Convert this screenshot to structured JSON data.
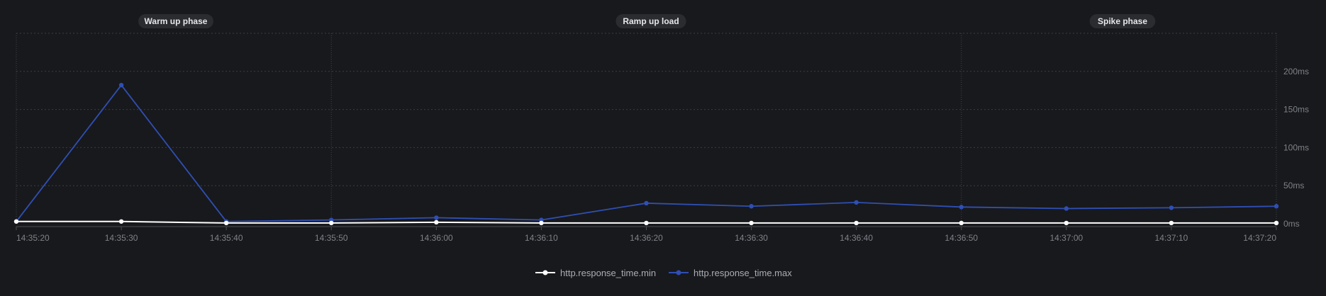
{
  "chart_data": {
    "type": "line",
    "x": [
      "14:35:20",
      "14:35:30",
      "14:35:40",
      "14:35:50",
      "14:36:00",
      "14:36:10",
      "14:36:20",
      "14:36:30",
      "14:36:40",
      "14:36:50",
      "14:37:00",
      "14:37:10",
      "14:37:20"
    ],
    "xlim": [
      "14:35:20",
      "14:37:20"
    ],
    "ylim": [
      0,
      250
    ],
    "yticks": [
      "0ms",
      "50ms",
      "100ms",
      "150ms",
      "200ms"
    ],
    "ytick_values": [
      0,
      50,
      100,
      150,
      200
    ],
    "grid": true,
    "legend_position": "bottom-center",
    "series": [
      {
        "name": "http.response_time.min",
        "color": "#ffffff",
        "values": [
          3,
          3,
          1,
          1,
          2,
          1,
          1,
          1,
          1,
          1,
          1,
          1,
          1
        ]
      },
      {
        "name": "http.response_time.max",
        "color": "#2f4fb5",
        "values": [
          3,
          182,
          3,
          5,
          8,
          5,
          27,
          23,
          28,
          22,
          20,
          21,
          23
        ]
      }
    ],
    "annotations": [
      {
        "label": "Warm up phase",
        "start": "14:35:20",
        "end": "14:35:50"
      },
      {
        "label": "Ramp up load",
        "start": "14:35:50",
        "end": "14:36:50"
      },
      {
        "label": "Spike phase",
        "start": "14:36:50",
        "end": "14:37:20"
      }
    ]
  },
  "colors": {
    "background": "#18191c",
    "grid": "#3a3d42",
    "axis": "#4a4d52",
    "phase_badge": "#2a2c30",
    "phase_line": "#3f4247"
  }
}
